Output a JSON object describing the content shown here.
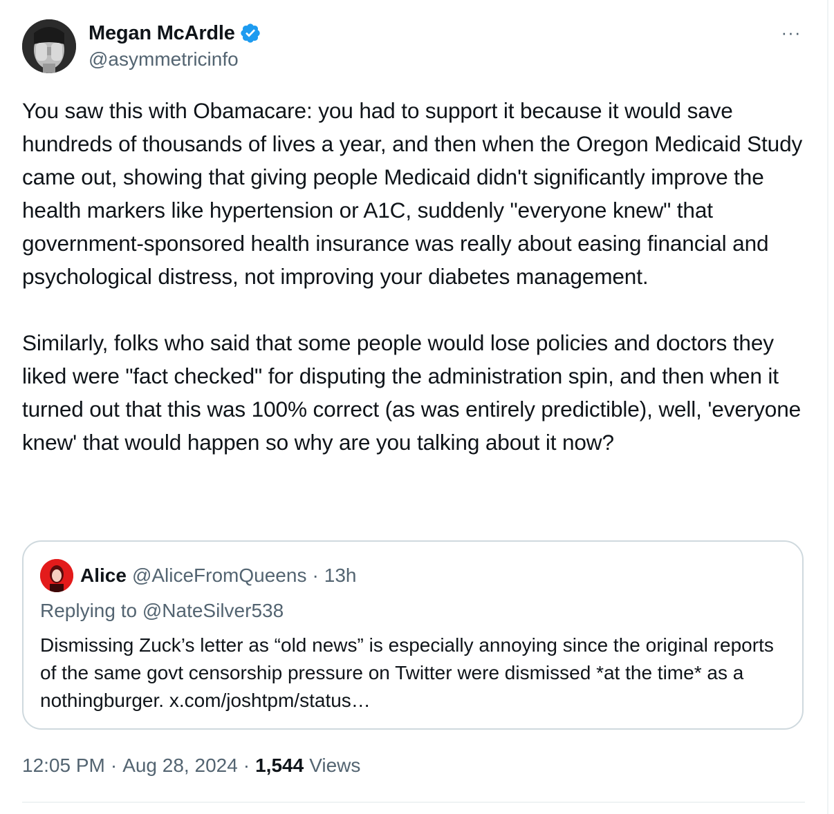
{
  "author": {
    "name": "Megan McArdle",
    "handle": "@asymmetricinfo",
    "verified_icon": "verified-badge-icon",
    "verified_color": "#1d9bf0"
  },
  "more_label": "···",
  "tweet": {
    "paragraphs": [
      "You saw this with Obamacare: you had to support it because it would save hundreds of thousands of lives a year, and then when the Oregon Medicaid Study came out, showing that giving people Medicaid didn't significantly improve the health markers like hypertension or A1C, suddenly \"everyone knew\" that government-sponsored health insurance was really about easing financial and psychological distress, not improving your diabetes management.",
      "Similarly, folks who said that some people would lose policies and doctors they liked were \"fact checked\" for disputing the administration spin, and then when it turned out that this was 100% correct (as was entirely predictible), well, 'everyone knew' that would happen so why are you talking about it now?"
    ]
  },
  "quote": {
    "name": "Alice",
    "handle": "@AliceFromQueens",
    "dot": "·",
    "time": "13h",
    "replying_to": "Replying to @NateSilver538",
    "text": "Dismissing Zuck’s letter as “old news” is especially annoying since the original reports of the same govt censorship pressure on Twitter were dismissed *at the time* as a nothingburger. x.com/joshtpm/status…"
  },
  "meta": {
    "time": "12:05 PM",
    "date": "Aug 28, 2024",
    "sep": "·",
    "views_count": "1,544",
    "views_label": "Views"
  },
  "colors": {
    "text": "#0f1419",
    "secondary": "#536471",
    "border": "#cfd9de"
  }
}
